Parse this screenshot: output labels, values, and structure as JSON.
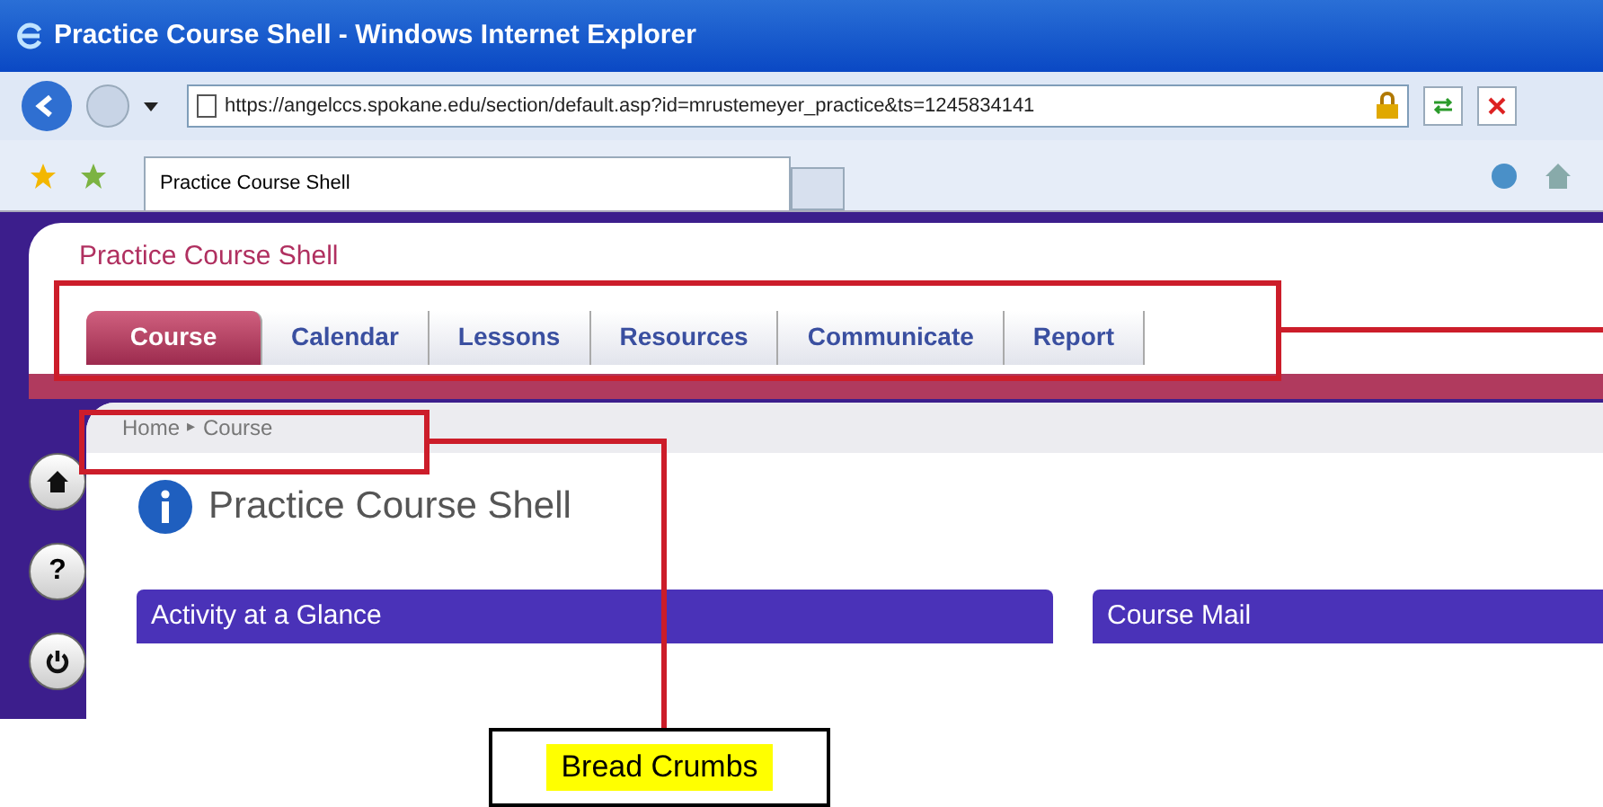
{
  "window": {
    "title": "Practice Course Shell - Windows Internet Explorer"
  },
  "address_bar": {
    "url": "https://angelccs.spokane.edu/section/default.asp?id=mrustemeyer_practice&ts=1245834141"
  },
  "browser_tabs": [
    {
      "label": "Practice Course Shell",
      "selected": true
    }
  ],
  "course": {
    "title": "Practice Course Shell"
  },
  "tabs": [
    {
      "label": "Course",
      "selected": true
    },
    {
      "label": "Calendar",
      "selected": false
    },
    {
      "label": "Lessons",
      "selected": false
    },
    {
      "label": "Resources",
      "selected": false
    },
    {
      "label": "Communicate",
      "selected": false
    },
    {
      "label": "Report",
      "selected": false
    }
  ],
  "breadcrumbs": [
    "Home",
    "Course"
  ],
  "breadcrumb_separator": "▸",
  "side_buttons": [
    {
      "kind": "home"
    },
    {
      "kind": "help"
    },
    {
      "kind": "power"
    }
  ],
  "side_button_text": {
    "help": "?"
  },
  "page_heading": "Practice Course Shell",
  "panels": [
    {
      "title": "Activity at a Glance"
    },
    {
      "title": "Course Mail"
    }
  ],
  "callout": {
    "label": "Bread Crumbs"
  }
}
